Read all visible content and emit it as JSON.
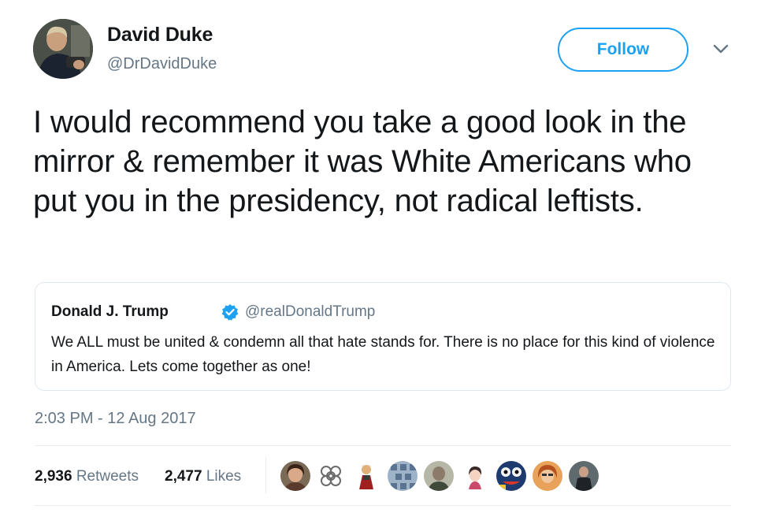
{
  "author": {
    "name": "David Duke",
    "handle": "@DrDavidDuke",
    "avatar_icon": "profile-photo"
  },
  "follow_label": "Follow",
  "menu_icon": "chevron-down-icon",
  "tweet_text": "I would recommend you take a good look in the mirror & remember it was White Americans who put you in the presidency, not radical leftists.",
  "quoted_tweet": {
    "name": "Donald J. Trump",
    "verified": true,
    "handle": "@realDonaldTrump",
    "text": "We ALL must be united & condemn all that hate stands for. There is no place for this kind of violence in America. Lets come together as one!"
  },
  "timestamp": "2:03 PM - 12 Aug 2017",
  "stats": {
    "retweets_count": "2,936",
    "retweets_label": "Retweets",
    "likes_count": "2,477",
    "likes_label": "Likes"
  },
  "likers": [
    {
      "icon": "avatar-woman-dark-hair"
    },
    {
      "icon": "avatar-celtic-knot"
    },
    {
      "icon": "avatar-cartoon-figure"
    },
    {
      "icon": "avatar-patterned"
    },
    {
      "icon": "avatar-man-grey"
    },
    {
      "icon": "avatar-anime-girl"
    },
    {
      "icon": "avatar-colorful-cartoon"
    },
    {
      "icon": "avatar-woman-red-hair"
    },
    {
      "icon": "avatar-man-dark"
    }
  ],
  "colors": {
    "accent": "#1da1f2",
    "text": "#14171a",
    "secondary_text": "#657786",
    "border": "#e1e8ed"
  }
}
